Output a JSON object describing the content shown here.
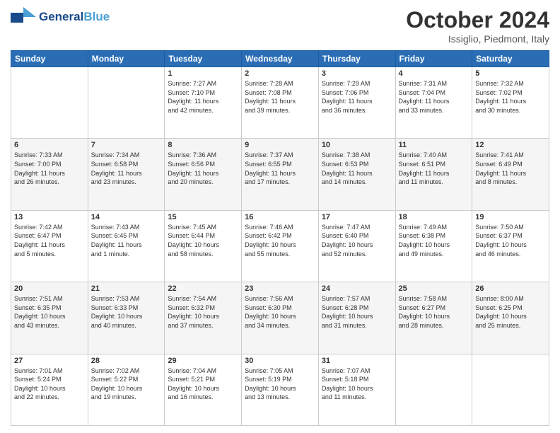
{
  "header": {
    "logo_line1": "General",
    "logo_line2": "Blue",
    "title": "October 2024",
    "location": "Issiglio, Piedmont, Italy"
  },
  "days_of_week": [
    "Sunday",
    "Monday",
    "Tuesday",
    "Wednesday",
    "Thursday",
    "Friday",
    "Saturday"
  ],
  "weeks": [
    [
      {
        "day": "",
        "info": ""
      },
      {
        "day": "",
        "info": ""
      },
      {
        "day": "1",
        "info": "Sunrise: 7:27 AM\nSunset: 7:10 PM\nDaylight: 11 hours\nand 42 minutes."
      },
      {
        "day": "2",
        "info": "Sunrise: 7:28 AM\nSunset: 7:08 PM\nDaylight: 11 hours\nand 39 minutes."
      },
      {
        "day": "3",
        "info": "Sunrise: 7:29 AM\nSunset: 7:06 PM\nDaylight: 11 hours\nand 36 minutes."
      },
      {
        "day": "4",
        "info": "Sunrise: 7:31 AM\nSunset: 7:04 PM\nDaylight: 11 hours\nand 33 minutes."
      },
      {
        "day": "5",
        "info": "Sunrise: 7:32 AM\nSunset: 7:02 PM\nDaylight: 11 hours\nand 30 minutes."
      }
    ],
    [
      {
        "day": "6",
        "info": "Sunrise: 7:33 AM\nSunset: 7:00 PM\nDaylight: 11 hours\nand 26 minutes."
      },
      {
        "day": "7",
        "info": "Sunrise: 7:34 AM\nSunset: 6:58 PM\nDaylight: 11 hours\nand 23 minutes."
      },
      {
        "day": "8",
        "info": "Sunrise: 7:36 AM\nSunset: 6:56 PM\nDaylight: 11 hours\nand 20 minutes."
      },
      {
        "day": "9",
        "info": "Sunrise: 7:37 AM\nSunset: 6:55 PM\nDaylight: 11 hours\nand 17 minutes."
      },
      {
        "day": "10",
        "info": "Sunrise: 7:38 AM\nSunset: 6:53 PM\nDaylight: 11 hours\nand 14 minutes."
      },
      {
        "day": "11",
        "info": "Sunrise: 7:40 AM\nSunset: 6:51 PM\nDaylight: 11 hours\nand 11 minutes."
      },
      {
        "day": "12",
        "info": "Sunrise: 7:41 AM\nSunset: 6:49 PM\nDaylight: 11 hours\nand 8 minutes."
      }
    ],
    [
      {
        "day": "13",
        "info": "Sunrise: 7:42 AM\nSunset: 6:47 PM\nDaylight: 11 hours\nand 5 minutes."
      },
      {
        "day": "14",
        "info": "Sunrise: 7:43 AM\nSunset: 6:45 PM\nDaylight: 11 hours\nand 1 minute."
      },
      {
        "day": "15",
        "info": "Sunrise: 7:45 AM\nSunset: 6:44 PM\nDaylight: 10 hours\nand 58 minutes."
      },
      {
        "day": "16",
        "info": "Sunrise: 7:46 AM\nSunset: 6:42 PM\nDaylight: 10 hours\nand 55 minutes."
      },
      {
        "day": "17",
        "info": "Sunrise: 7:47 AM\nSunset: 6:40 PM\nDaylight: 10 hours\nand 52 minutes."
      },
      {
        "day": "18",
        "info": "Sunrise: 7:49 AM\nSunset: 6:38 PM\nDaylight: 10 hours\nand 49 minutes."
      },
      {
        "day": "19",
        "info": "Sunrise: 7:50 AM\nSunset: 6:37 PM\nDaylight: 10 hours\nand 46 minutes."
      }
    ],
    [
      {
        "day": "20",
        "info": "Sunrise: 7:51 AM\nSunset: 6:35 PM\nDaylight: 10 hours\nand 43 minutes."
      },
      {
        "day": "21",
        "info": "Sunrise: 7:53 AM\nSunset: 6:33 PM\nDaylight: 10 hours\nand 40 minutes."
      },
      {
        "day": "22",
        "info": "Sunrise: 7:54 AM\nSunset: 6:32 PM\nDaylight: 10 hours\nand 37 minutes."
      },
      {
        "day": "23",
        "info": "Sunrise: 7:56 AM\nSunset: 6:30 PM\nDaylight: 10 hours\nand 34 minutes."
      },
      {
        "day": "24",
        "info": "Sunrise: 7:57 AM\nSunset: 6:28 PM\nDaylight: 10 hours\nand 31 minutes."
      },
      {
        "day": "25",
        "info": "Sunrise: 7:58 AM\nSunset: 6:27 PM\nDaylight: 10 hours\nand 28 minutes."
      },
      {
        "day": "26",
        "info": "Sunrise: 8:00 AM\nSunset: 6:25 PM\nDaylight: 10 hours\nand 25 minutes."
      }
    ],
    [
      {
        "day": "27",
        "info": "Sunrise: 7:01 AM\nSunset: 5:24 PM\nDaylight: 10 hours\nand 22 minutes."
      },
      {
        "day": "28",
        "info": "Sunrise: 7:02 AM\nSunset: 5:22 PM\nDaylight: 10 hours\nand 19 minutes."
      },
      {
        "day": "29",
        "info": "Sunrise: 7:04 AM\nSunset: 5:21 PM\nDaylight: 10 hours\nand 16 minutes."
      },
      {
        "day": "30",
        "info": "Sunrise: 7:05 AM\nSunset: 5:19 PM\nDaylight: 10 hours\nand 13 minutes."
      },
      {
        "day": "31",
        "info": "Sunrise: 7:07 AM\nSunset: 5:18 PM\nDaylight: 10 hours\nand 11 minutes."
      },
      {
        "day": "",
        "info": ""
      },
      {
        "day": "",
        "info": ""
      }
    ]
  ]
}
